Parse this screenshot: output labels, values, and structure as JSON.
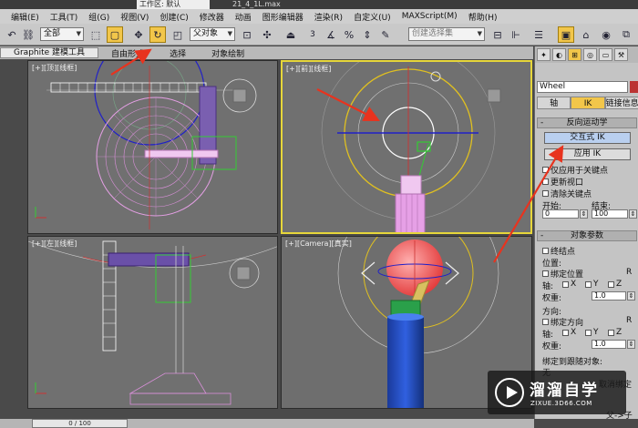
{
  "title_bar": {
    "workspace": "工作区: 默认",
    "file_name": "21_4_1L.max"
  },
  "menu": [
    "编辑(E)",
    "工具(T)",
    "组(G)",
    "视图(V)",
    "创建(C)",
    "修改器",
    "动画",
    "图形编辑器",
    "渲染(R)",
    "自定义(U)",
    "MAXScript(M)",
    "帮助(H)"
  ],
  "toolbar": {
    "undo_icon": "undo-icon",
    "selection_filter": "全部",
    "reference_coord": "父对象",
    "selection_set_placeholder": "创建选择集",
    "angle_snap_value": "3",
    "snap_value": "2.5"
  },
  "ribbon": {
    "tabs": [
      "Graphite 建模工具",
      "自由形式",
      "选择",
      "对象绘制"
    ]
  },
  "viewports": {
    "top": {
      "label": "[+][顶][线框]"
    },
    "front": {
      "label": "[+][前][线框]"
    },
    "left": {
      "label": "[+][左][线框]"
    },
    "camera": {
      "label": "[+][Camera][真实]"
    }
  },
  "command_panel": {
    "object_name": "Wheel",
    "color_swatch": "#b33333",
    "subtabs": [
      "轴",
      "IK",
      "链接信息"
    ],
    "ik_rollout": {
      "title": "反向运动学",
      "interactive_ik": "交互式 IK",
      "apply_ik": "应用 IK",
      "apply_to_keys": "仅应用于关键点",
      "update_viewports": "更新视口",
      "clear_keys": "清除关键点",
      "start_label": "开始:",
      "start_value": "0",
      "end_label": "结束:",
      "end_value": "100"
    },
    "object_params": {
      "title": "对象参数",
      "terminator": "终结点",
      "position_label": "位置:",
      "bind_position": "绑定位置",
      "r_label": "R",
      "axis_label": "轴:",
      "x": "X",
      "y": "Y",
      "z": "Z",
      "weight_label": "权重:",
      "weight_value": "1.0",
      "orientation_label": "方向:",
      "bind_orientation": "绑定方向",
      "bind_follow_label": "绑定到跟随对象:",
      "none_label": "无",
      "unbind_label": "取消绑定",
      "parent_child": "父->子"
    }
  },
  "status": {
    "frame": "0 / 100"
  },
  "watermark": {
    "brand": "溜溜自学",
    "url": "ZIXUE.3D66.COM"
  }
}
